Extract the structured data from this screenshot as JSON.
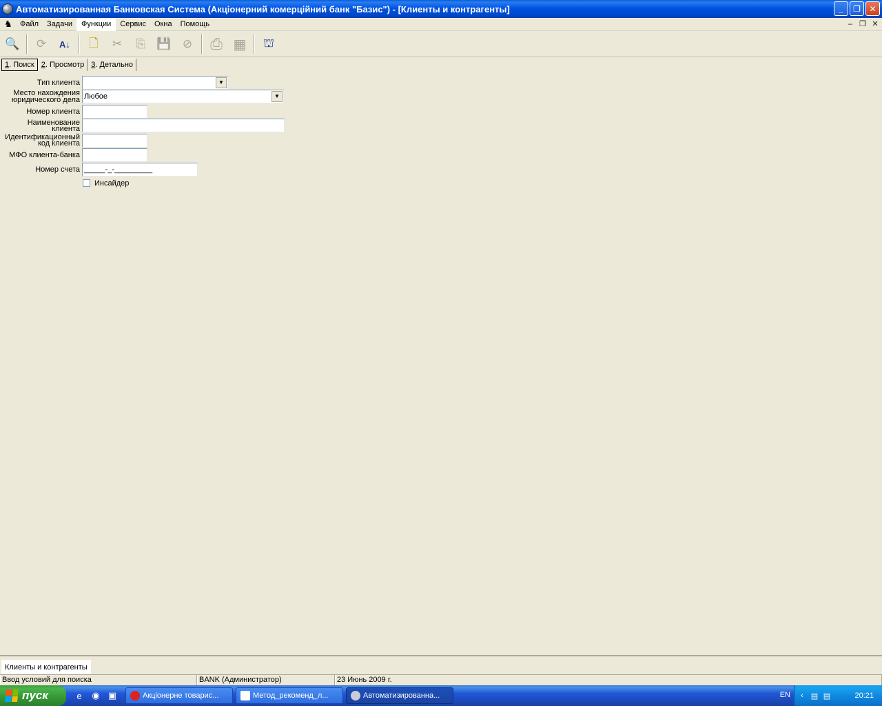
{
  "window": {
    "title": "Автоматизированная Банковская Система (Акціонерний комерційний банк \"Базис\") - [Клиенты и контрагенты]",
    "buttons": {
      "minimize": "_",
      "maximize": "❐",
      "close": "✕"
    }
  },
  "menu": {
    "items": [
      "Файл",
      "Задачи",
      "Функции",
      "Сервис",
      "Окна",
      "Помощь"
    ],
    "active_index": 2
  },
  "toolbar": {
    "tools": [
      {
        "icon": "magnifier-icon",
        "glyph": "🔍",
        "enabled": true
      },
      {
        "icon": "refresh-icon",
        "glyph": "⟳",
        "enabled": false
      },
      {
        "icon": "sort-az-icon",
        "glyph": "A↓",
        "enabled": true
      },
      {
        "icon": "new-document-icon",
        "glyph": "🗋",
        "enabled": true
      },
      {
        "icon": "cut-icon",
        "glyph": "✂",
        "enabled": false
      },
      {
        "icon": "copy-icon",
        "glyph": "⎘",
        "enabled": false
      },
      {
        "icon": "save-icon",
        "glyph": "💾",
        "enabled": false
      },
      {
        "icon": "cancel-icon",
        "glyph": "⊘",
        "enabled": false
      },
      {
        "icon": "print-icon",
        "glyph": "⎙",
        "enabled": false
      },
      {
        "icon": "calculator-icon",
        "glyph": "▦",
        "enabled": false
      },
      {
        "icon": "exit-door-icon",
        "glyph": "⛫",
        "enabled": true
      }
    ]
  },
  "tabs": [
    {
      "num": "1",
      "label": ". Поиск"
    },
    {
      "num": "2",
      "label": ". Просмотр"
    },
    {
      "num": "3",
      "label": ". Детально"
    }
  ],
  "form": {
    "client_type": {
      "label": "Тип клиента",
      "value": ""
    },
    "legal_location": {
      "label_line1": "Место нахождения",
      "label_line2": "юридического дела",
      "value": "Любое"
    },
    "client_number": {
      "label": "Номер клиента",
      "value": ""
    },
    "client_name": {
      "label_line1": "Наименование",
      "label_line2": "клиента",
      "value": ""
    },
    "id_code": {
      "label_line1": "Идентификационный",
      "label_line2": "код клиента",
      "value": ""
    },
    "bank_mfo": {
      "label": "МФО клиента-банка",
      "value": ""
    },
    "account_number": {
      "label": "Номер счета",
      "value": "_____-_-_________"
    },
    "insider": {
      "label": "Инсайдер",
      "checked": false
    }
  },
  "task_strip": {
    "item": "Клиенты и контрагенты"
  },
  "status": {
    "hint": "Ввод условий для поиска",
    "user": "BANK (Администратор)",
    "date": "23 Июнь 2009 г."
  },
  "taskbar": {
    "start_label": "пуск",
    "buttons": [
      "Акціонерне товарис...",
      "Метод_рекоменд_л...",
      "Автоматизированна..."
    ],
    "active_index": 2,
    "lang": "EN",
    "clock": "20:21"
  }
}
